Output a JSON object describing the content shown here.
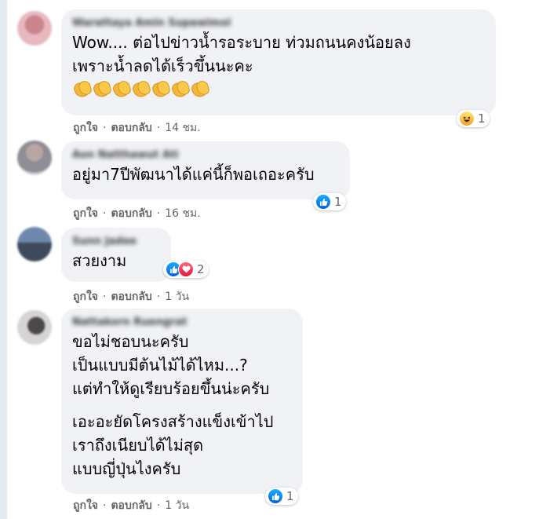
{
  "comments": [
    {
      "author": "Warattaya Amin Supawimol",
      "lines": [
        "Wow.... ต่อไปข่าวน้ำรอระบาย ท่วมถนนคงน้อยลง",
        "เพราะน้ำลดได้เร็วขึ้นนะคะ"
      ],
      "emoji_icons": [
        "clapping-hands",
        "clapping-hands",
        "clapping-hands",
        "clapping-hands",
        "clapping-hands",
        "clapping-hands",
        "clapping-hands"
      ],
      "like_label": "ถูกใจ",
      "reply_label": "ตอบกลับ",
      "time": "14 ชม.",
      "reaction_icons": [
        "haha"
      ],
      "reaction_count": "1"
    },
    {
      "author": "Aon Natthawut Ati",
      "lines": [
        "อยู่มา7ปีพัฒนาได้แค่นี้ก็พอเถอะครับ"
      ],
      "like_label": "ถูกใจ",
      "reply_label": "ตอบกลับ",
      "time": "16 ชม.",
      "reaction_icons": [
        "like"
      ],
      "reaction_count": "1"
    },
    {
      "author": "Sunn Jadee",
      "lines": [
        "สวยงาม"
      ],
      "like_label": "ถูกใจ",
      "reply_label": "ตอบกลับ",
      "time": "1 วัน",
      "reaction_icons": [
        "like",
        "love"
      ],
      "reaction_count": "2"
    },
    {
      "author": "Nattakorn Ruengrat",
      "paragraphs": [
        [
          "ขอไม่ชอบนะครับ",
          "เป็นแบบมีต้นไม้ได้ไหม...?",
          "แต่ทำให้ดูเรียบร้อยขึ้นน่ะครับ"
        ],
        [
          "เอะอะยัดโครงสร้างแข็งเข้าไป",
          "เราถึงเนียบได้ไม่สุด",
          "แบบญี่ปุ่นไงครับ"
        ]
      ],
      "like_label": "ถูกใจ",
      "reply_label": "ตอบกลับ",
      "time": "1 วัน",
      "reaction_icons": [
        "like"
      ],
      "reaction_count": "1"
    }
  ],
  "separator": "·",
  "colors": {
    "bubble": "#f0f2f5",
    "meta_text": "#65676b",
    "like_blue": "#1877f2",
    "love_red": "#f33e58",
    "haha_yellow": "#f7b125"
  }
}
